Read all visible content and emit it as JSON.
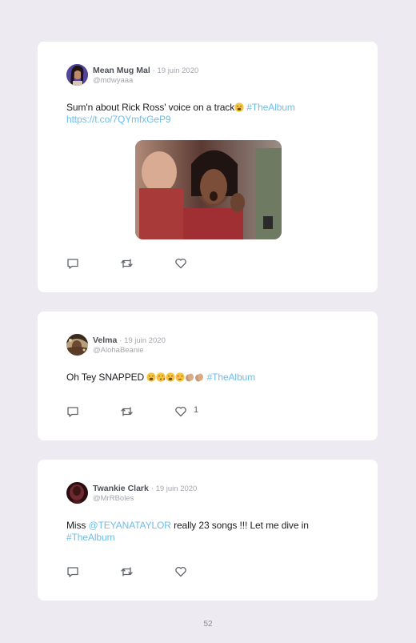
{
  "page_number": "52",
  "tweets": [
    {
      "name": "Mean Mug Mal",
      "date": "· 19 juin 2020",
      "handle": "@mdwyaaa",
      "text_before": "Sum'n about Rick Ross' voice on a track",
      "hashtag": "#TheAlbum",
      "url": "https://t.co/7QYmfxGeP9",
      "emoji": [
        "weary-face"
      ],
      "like_count": ""
    },
    {
      "name": "Velma",
      "date": "· 19 juin 2020",
      "handle": "@AlohaBeanie",
      "text_before": "Oh Tey SNAPPED",
      "hashtag": "#TheAlbum",
      "emoji": [
        "weary-face",
        "face-blowing-kiss",
        "weary-face",
        "heart-eyes-face",
        "clapping-hands",
        "clapping-hands"
      ],
      "like_count": "1"
    },
    {
      "name": "Twankie Clark",
      "date": "· 19 juin 2020",
      "handle": "@MrRBoles",
      "text_before": "Miss",
      "mention": "@TEYANATAYLOR",
      "text_after": " really 23 songs !!! Let me dive in",
      "hashtag": "#TheAlbum",
      "like_count": ""
    }
  ]
}
